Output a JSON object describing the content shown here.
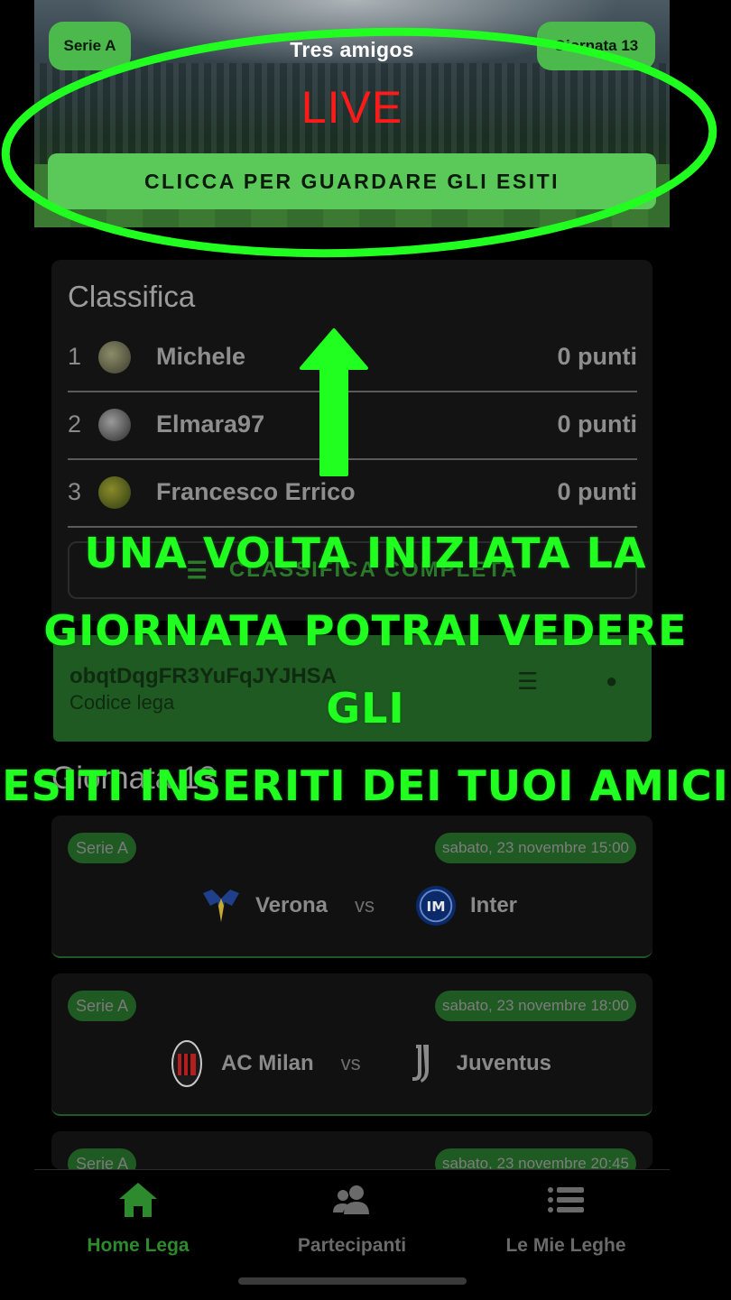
{
  "hero": {
    "league_badge": "Serie A",
    "league_name": "Tres amigos",
    "matchday_badge": "Giornata 13",
    "live_label": "LIVE",
    "outcomes_button": "CLICCA PER GUARDARE GLI ESITI"
  },
  "standings": {
    "title": "Classifica",
    "rows": [
      {
        "rank": "1",
        "name": "Michele",
        "points": "0 punti"
      },
      {
        "rank": "2",
        "name": "Elmara97",
        "points": "0 punti"
      },
      {
        "rank": "3",
        "name": "Francesco Errico",
        "points": "0 punti"
      }
    ],
    "full_button": "CLASSIFICA COMPLETA"
  },
  "league_code": {
    "code": "obqtDqgFR3YuFqJYJHSA",
    "subtitle": "Codice lega"
  },
  "matchday": {
    "title": "Giornata 13",
    "matches": [
      {
        "competition": "Serie A",
        "datetime": "sabato, 23 novembre 15:00",
        "home": "Verona",
        "away": "Inter",
        "vs": "vs"
      },
      {
        "competition": "Serie A",
        "datetime": "sabato, 23 novembre 18:00",
        "home": "AC Milan",
        "away": "Juventus",
        "vs": "vs"
      },
      {
        "competition": "Serie A",
        "datetime": "sabato, 23 novembre 20:45"
      }
    ]
  },
  "annotation": {
    "line1": "Una volta iniziata la",
    "line2": "giornata potrai vedere gli",
    "line3": "esiti inseriti dei tuoi amici"
  },
  "nav": {
    "home": "Home Lega",
    "participants": "Partecipanti",
    "my_leagues": "Le Mie Leghe"
  },
  "colors": {
    "accent": "#4cb94c",
    "live": "#ff1a1a",
    "annotation": "#20ff20",
    "nav_active": "#2d8a2d",
    "nav_inactive": "#6a6a6a"
  }
}
